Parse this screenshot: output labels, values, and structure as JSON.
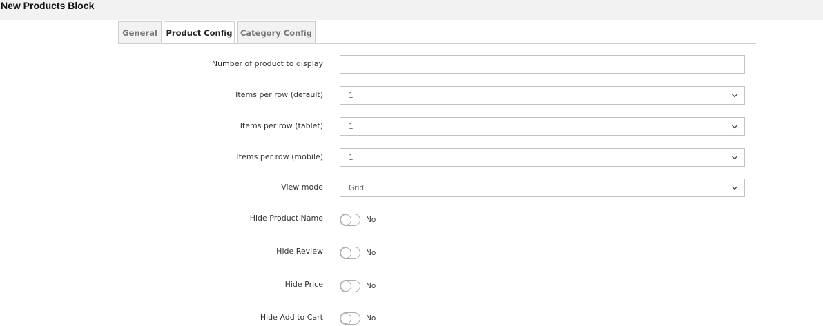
{
  "page": {
    "title": "New Products Block"
  },
  "tabs": [
    {
      "label": "General",
      "active": false
    },
    {
      "label": "Product Config",
      "active": true
    },
    {
      "label": "Category Config",
      "active": false
    }
  ],
  "form": {
    "number_of_products": {
      "label": "Number of product to display",
      "value": ""
    },
    "items_default": {
      "label": "Items per row (default)",
      "value": "1"
    },
    "items_tablet": {
      "label": "Items per row (tablet)",
      "value": "1"
    },
    "items_mobile": {
      "label": "Items per row (mobile)",
      "value": "1"
    },
    "view_mode": {
      "label": "View mode",
      "value": "Grid"
    },
    "hide_product_name": {
      "label": "Hide Product Name",
      "state": "No"
    },
    "hide_review": {
      "label": "Hide Review",
      "state": "No"
    },
    "hide_price": {
      "label": "Hide Price",
      "state": "No"
    },
    "hide_add_to_cart": {
      "label": "Hide Add to Cart",
      "state": "No"
    }
  },
  "icons": {
    "select_arrow": "chevron-down-icon"
  }
}
